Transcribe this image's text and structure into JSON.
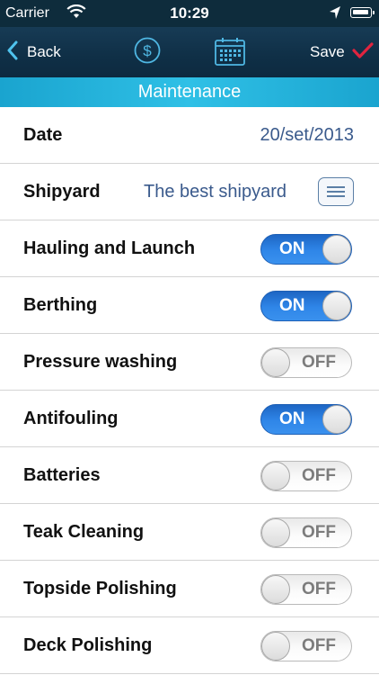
{
  "status_bar": {
    "carrier": "Carrier",
    "time": "10:29",
    "icons": [
      "wifi-icon",
      "location-arrow-icon",
      "battery-icon"
    ]
  },
  "nav": {
    "back_label": "Back",
    "save_label": "Save",
    "icons": [
      "chevron-left-icon",
      "dollar-icon",
      "calendar-icon",
      "checkmark-icon"
    ],
    "colors": {
      "accent": "#e0243f",
      "bar": "#133550"
    }
  },
  "section": {
    "title": "Maintenance",
    "color": "#22b2dc"
  },
  "form": {
    "date": {
      "label": "Date",
      "value": "20/set/2013"
    },
    "shipyard": {
      "label": "Shipyard",
      "value": "The best shipyard"
    },
    "toggles": [
      {
        "label": "Hauling and Launch",
        "state": "ON"
      },
      {
        "label": "Berthing",
        "state": "ON"
      },
      {
        "label": "Pressure washing",
        "state": "OFF"
      },
      {
        "label": "Antifouling",
        "state": "ON"
      },
      {
        "label": "Batteries",
        "state": "OFF"
      },
      {
        "label": "Teak Cleaning",
        "state": "OFF"
      },
      {
        "label": "Topside Polishing",
        "state": "OFF"
      },
      {
        "label": "Deck Polishing",
        "state": "OFF"
      }
    ]
  }
}
